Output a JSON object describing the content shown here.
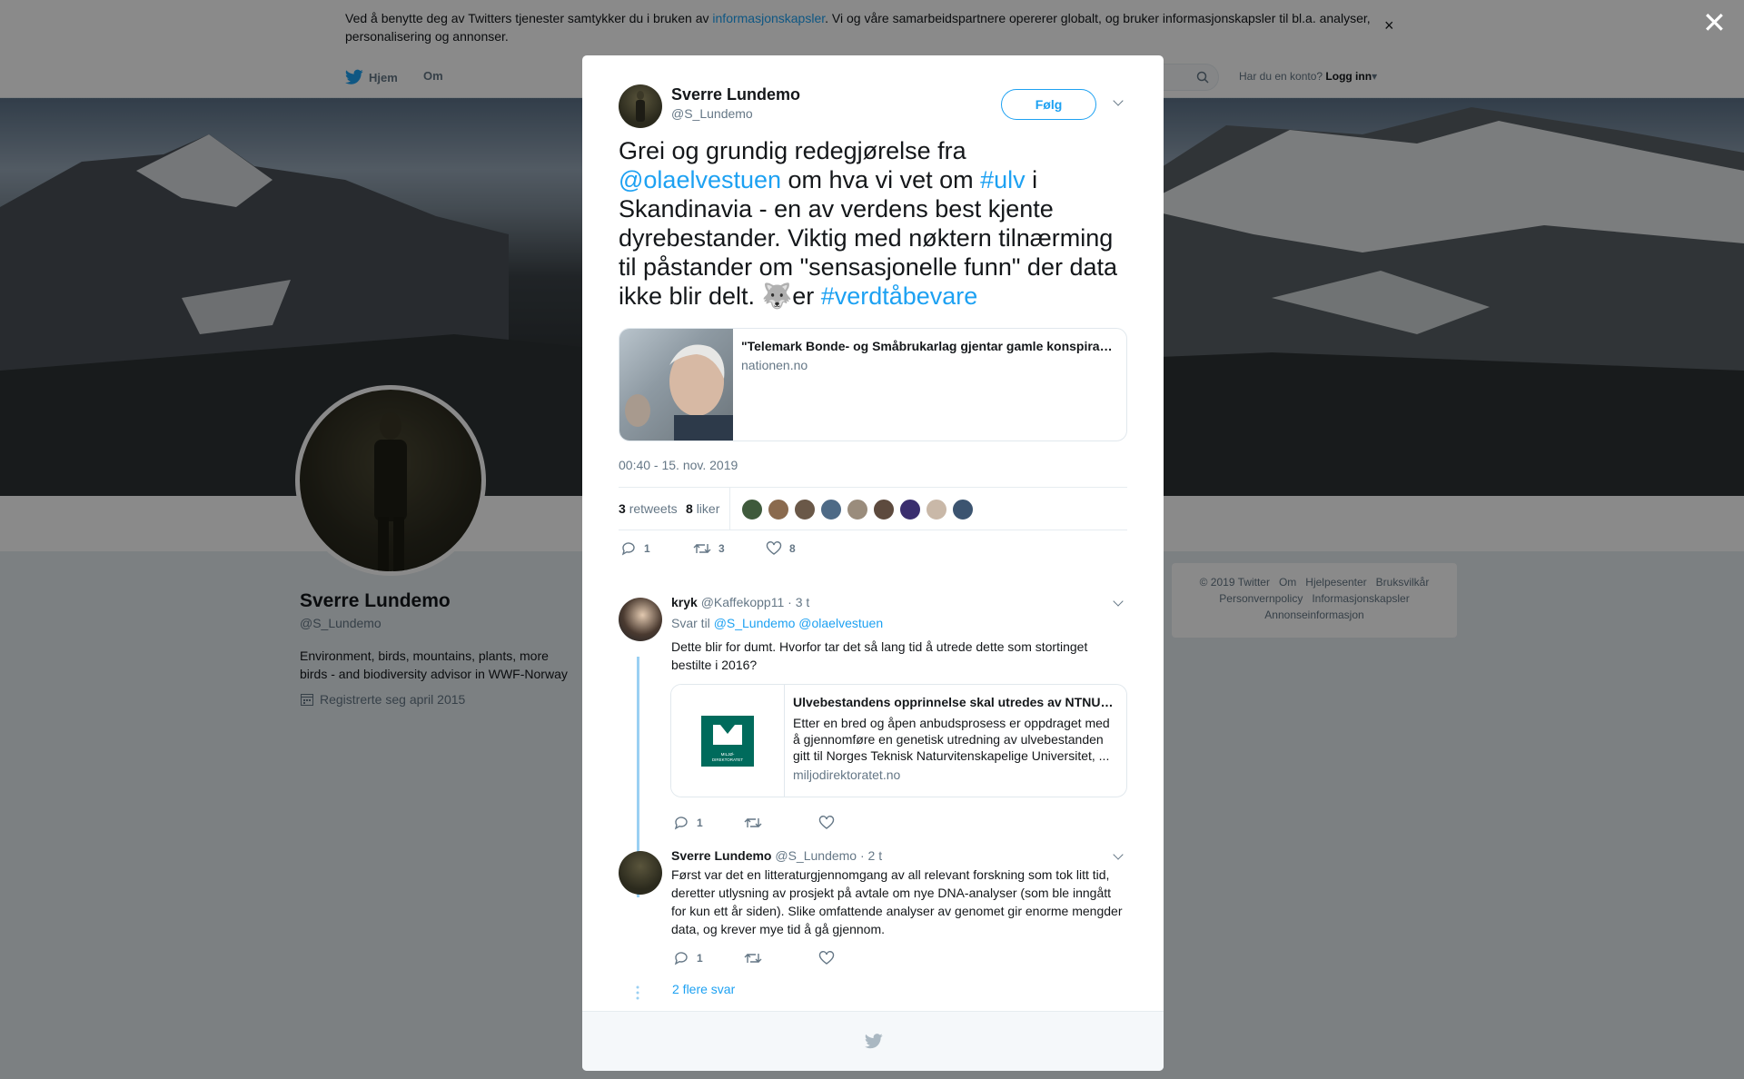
{
  "cookie_banner": {
    "text_before": "Ved å benytte deg av Twitters tjenester samtykker du i bruken av ",
    "link": "informasjonskapsler",
    "text_after": ". Vi og våre samarbeidspartnere opererer globalt, og bruker informasjonskapsler til bl.a. analyser, personalisering og annonser.",
    "close": "×"
  },
  "nav": {
    "home": "Hjem",
    "about": "Om",
    "login_prompt": "Har du en konto?",
    "login": "Logg inn"
  },
  "profile": {
    "name": "Sverre Lundemo",
    "handle": "@S_Lundemo",
    "bio": "Environment, birds, mountains, plants, more birds - and biodiversity advisor in WWF-Norway",
    "joined": "Registrerte seg april 2015"
  },
  "footer": {
    "links": [
      "© 2019 Twitter",
      "Om",
      "Hjelpesenter",
      "Bruksvilkår",
      "Personvernpolicy",
      "Informasjonskapsler",
      "Annonseinformasjon"
    ]
  },
  "overlay_close": "✕",
  "tweet": {
    "author": "Sverre Lundemo",
    "handle": "@S_Lundemo",
    "follow": "Følg",
    "text": {
      "p1": "Grei og grundig redegjørelse fra ",
      "mention": "@olaelvestuen",
      "p2": " om hva vi vet om ",
      "hashtag1": "#ulv",
      "p3": " i Skandinavia - en av verdens best kjente dyrebestander. Viktig med nøktern tilnærming til påstander om \"sensasjonelle funn\" der data ikke blir delt. ",
      "emoji": "🐺",
      "p4": "er ",
      "hashtag2": "#verdtåbevare"
    },
    "card": {
      "title": "\"Telemark Bonde- og Småbrukarlag gjentar gamle konspirasjonsteoriar\"",
      "domain": "nationen.no"
    },
    "timestamp": "00:40 - 15. nov. 2019",
    "retweets_count": "3",
    "retweets_label": "retweets",
    "likes_count": "8",
    "likes_label": "liker",
    "actions": {
      "replies": "1",
      "retweets": "3",
      "likes": "8"
    }
  },
  "replies": [
    {
      "name": "kryk",
      "handle": "@Kaffekopp11",
      "time": "· 3 t",
      "reply_to_label": "Svar til ",
      "reply_to": "@S_Lundemo @olaelvestuen",
      "text": "Dette blir for dumt. Hvorfor tar det så lang tid å utrede dette som stortinget bestilte i 2016?",
      "card": {
        "title": "Ulvebestandens opprinnelse skal utredes av NTNU og Universitetet i Oslo",
        "description": "Etter en bred og åpen anbudsprosess er oppdraget med å gjennomføre en genetisk utredning av ulvebestanden gitt til Norges Teknisk Naturvitenskapelige Universitet, ...",
        "domain": "miljodirektoratet.no",
        "logo_text": "MILJØ-\nDIREKTORATET"
      },
      "reply_count": "1"
    },
    {
      "name": "Sverre Lundemo",
      "handle": "@S_Lundemo",
      "time": "· 2 t",
      "text": "Først var det en litteraturgjennomgang av all relevant forskning som tok litt tid, deretter utlysning av prosjekt på avtale om nye DNA-analyser (som ble inngått for kun ett år siden). Slike omfattende analyser av genomet gir enorme mengder data, og krever mye tid å gå gjennom.",
      "reply_count": "1"
    }
  ],
  "more_replies": "2 flere svar",
  "colors": {
    "accent": "#1da1f2",
    "thread": "#9ad0f3",
    "muted": "#657786"
  }
}
